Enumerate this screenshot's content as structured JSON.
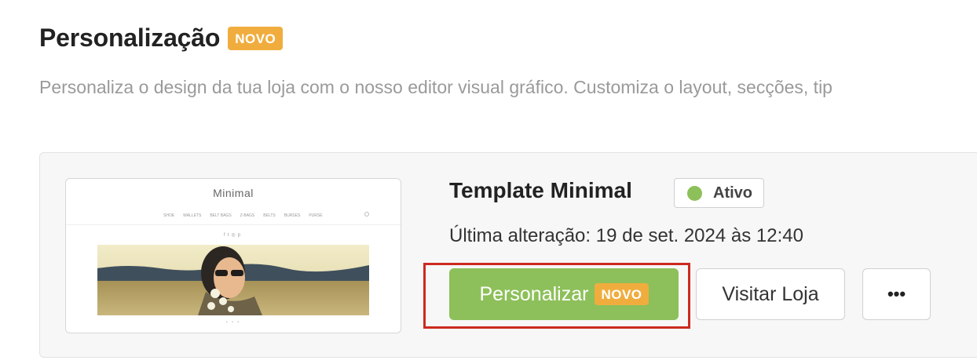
{
  "section": {
    "title": "Personalização",
    "title_badge": "NOVO",
    "description": "Personaliza o design da tua loja com o nosso editor visual gráfico. Customiza o layout, secções, tip"
  },
  "template_card": {
    "preview": {
      "logo_text": "Minimal",
      "nav_items": [
        "SHOE",
        "WALLETS",
        "BELT BAGS",
        "Z-BAGS",
        "BELTS",
        "BURSES",
        "PURSE"
      ],
      "social_icons": [
        "facebook-icon",
        "twitter-icon",
        "instagram-icon",
        "pinterest-icon"
      ]
    },
    "title": "Template Minimal",
    "status": {
      "label": "Ativo",
      "color": "#8dc05a"
    },
    "last_modified": "Última alteração: 19 de set. 2024 às 12:40",
    "buttons": {
      "customize_label": "Personalizar",
      "customize_badge": "NOVO",
      "visit_label": "Visitar Loja",
      "more_label": "•••"
    }
  },
  "colors": {
    "primary_green": "#8dc05a",
    "badge_orange": "#f0ad3e",
    "highlight_red": "#cc2a1f"
  }
}
